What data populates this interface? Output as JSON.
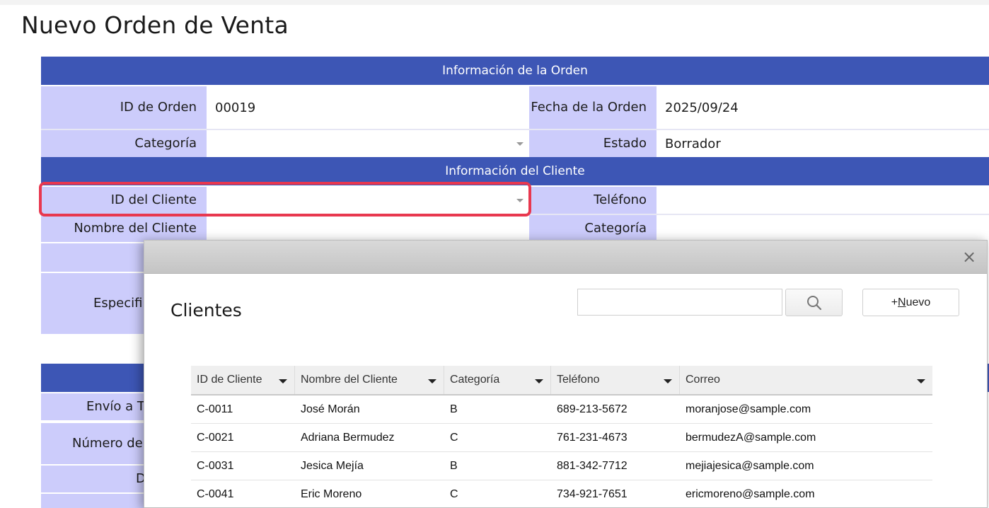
{
  "page_title": "Nuevo Orden de Venta",
  "sections": {
    "order_info": "Información de la Orden",
    "customer_info": "Información del Cliente"
  },
  "order": {
    "order_id_label": "ID de Orden",
    "order_id_value": "00019",
    "order_date_label": "Fecha de la Orden",
    "order_date_value": "2025/09/24",
    "category_label": "Categoría",
    "category_value": "",
    "status_label": "Estado",
    "status_value": "Borrador"
  },
  "customer": {
    "customer_id_label": "ID del Cliente",
    "customer_id_value": "",
    "phone_label": "Teléfono",
    "phone_value": "",
    "customer_name_label": "Nombre del Cliente",
    "customer_name_value": "",
    "category_label": "Categoría",
    "category_value": "",
    "spec_label_partial": "Especifi"
  },
  "shipping_partial": {
    "ship_to_label_partial": "Envío a T",
    "number_label_partial": "Número de",
    "d_label_partial": "D"
  },
  "dialog": {
    "title": "Clientes",
    "search_placeholder": "",
    "new_button_prefix": "+",
    "new_button_mnemonic": "N",
    "new_button_rest": "uevo",
    "close_glyph": "×",
    "columns": [
      "ID de Cliente",
      "Nombre del Cliente",
      "Categoría",
      "Teléfono",
      "Correo"
    ],
    "rows": [
      [
        "C-0011",
        "José Morán",
        "B",
        "689-213-5672",
        "moranjose@sample.com"
      ],
      [
        "C-0021",
        "Adriana Bermudez",
        "C",
        "761-231-4673",
        "bermudezA@sample.com"
      ],
      [
        "C-0031",
        "Jesica Mejía",
        "B",
        "881-342-7712",
        "mejiajesica@sample.com"
      ],
      [
        "C-0041",
        "Eric Moreno",
        "C",
        "734-921-7651",
        "ericmoreno@sample.com"
      ]
    ]
  },
  "colors": {
    "section_band": "#3d56b5",
    "label_bg": "#ccccfb",
    "highlight": "#e8384f"
  }
}
